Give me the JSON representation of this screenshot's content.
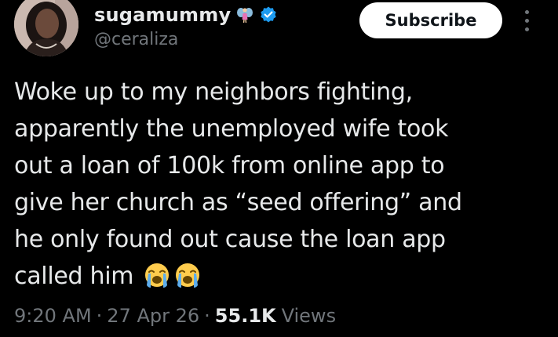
{
  "author": {
    "display_name": "sugamummy",
    "handle": "@ceraliza",
    "badge_icons": [
      "fairy-icon",
      "verified-badge-icon"
    ]
  },
  "actions": {
    "subscribe_label": "Subscribe",
    "more_icon": "more-vertical-icon"
  },
  "tweet": {
    "lines": [
      "Woke up to my neighbors fighting,",
      "apparently the unemployed wife took",
      "out a loan of 100k from online app to",
      "give her church as “seed offering” and",
      "he only found out cause the loan app",
      "called him"
    ],
    "emojis": [
      "loudly-crying-face-emoji",
      "loudly-crying-face-emoji"
    ]
  },
  "meta": {
    "time": "9:20 AM",
    "separator": "·",
    "date": "27 Apr 26",
    "views_count": "55.1K",
    "views_label": "Views"
  },
  "colors": {
    "background": "#000000",
    "text": "#e7e9ea",
    "muted": "#71767b",
    "verified": "#1d9bf0"
  }
}
